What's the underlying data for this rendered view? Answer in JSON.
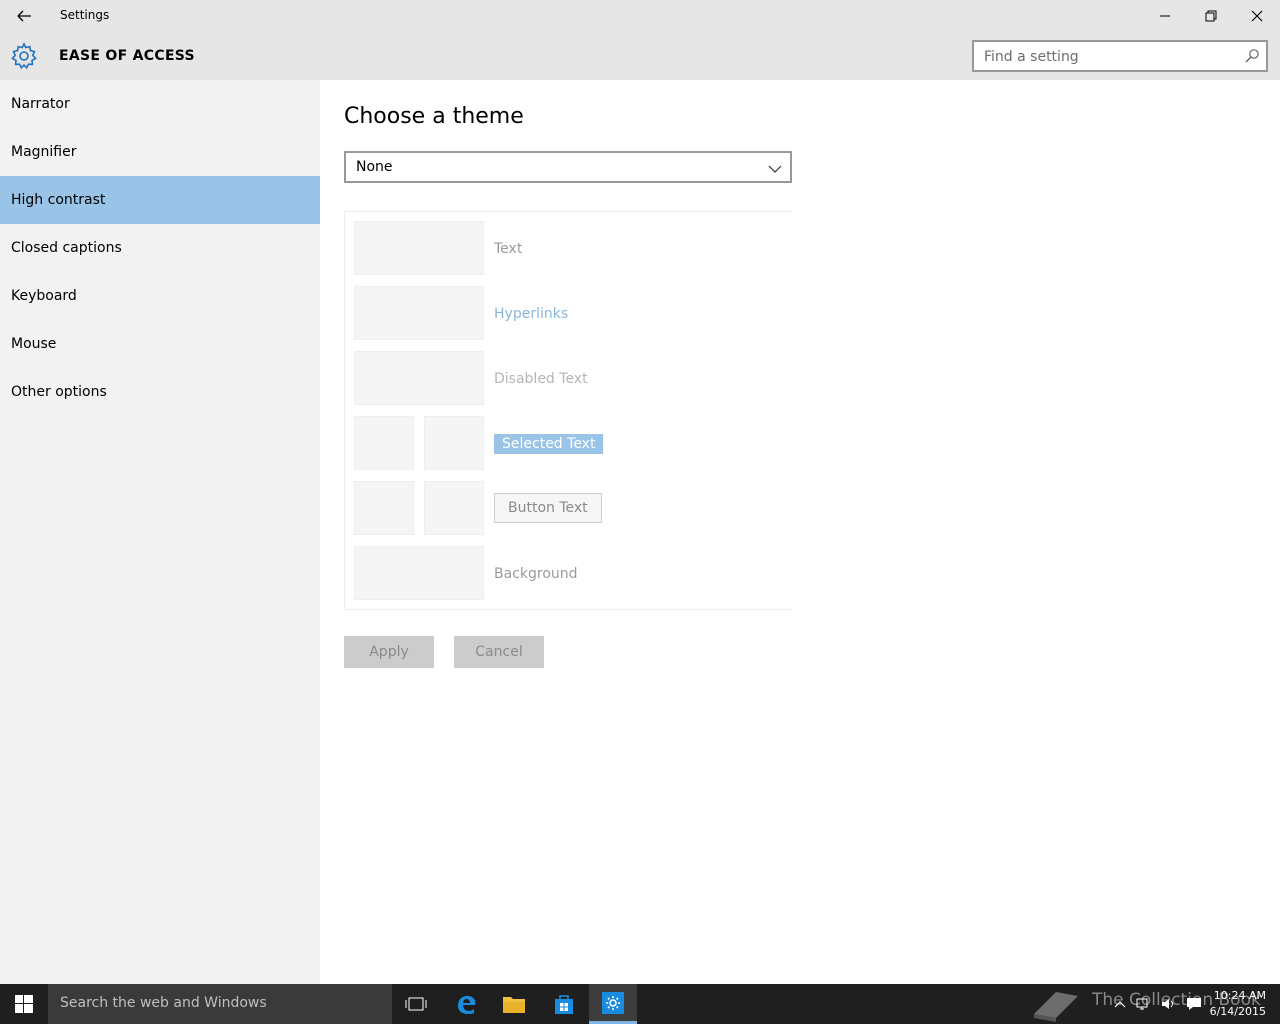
{
  "window": {
    "title": "Settings"
  },
  "header": {
    "section_title": "EASE OF ACCESS",
    "search_placeholder": "Find a setting"
  },
  "sidebar": {
    "items": [
      {
        "label": "Narrator",
        "active": false
      },
      {
        "label": "Magnifier",
        "active": false
      },
      {
        "label": "High contrast",
        "active": true
      },
      {
        "label": "Closed captions",
        "active": false
      },
      {
        "label": "Keyboard",
        "active": false
      },
      {
        "label": "Mouse",
        "active": false
      },
      {
        "label": "Other options",
        "active": false
      }
    ]
  },
  "main": {
    "heading": "Choose a theme",
    "theme_select": {
      "selected": "None"
    },
    "preview": {
      "text": "Text",
      "hyperlinks": "Hyperlinks",
      "disabled_text": "Disabled Text",
      "selected_text": "Selected Text",
      "button_text": "Button Text",
      "background": "Background"
    },
    "apply_label": "Apply",
    "cancel_label": "Cancel"
  },
  "taskbar": {
    "search_text": "Search the web and Windows",
    "watermark": "The Collection Book",
    "time": "10:24 AM",
    "date": "6/14/2015"
  },
  "colors": {
    "accent": "#99c4e8",
    "chrome": "#e6e6e6",
    "sidebar": "#f2f2f2",
    "taskbar": "#1f1f1f"
  }
}
